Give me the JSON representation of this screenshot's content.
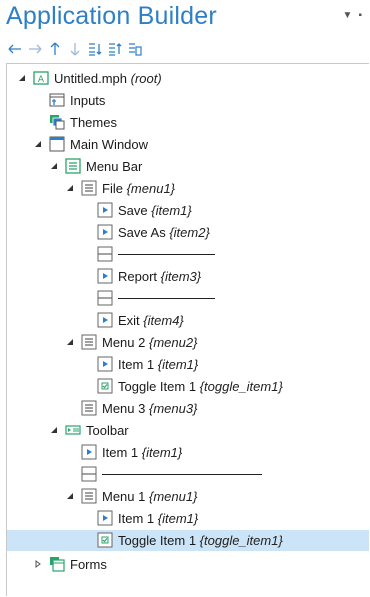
{
  "header": {
    "title": "Application Builder",
    "menu_icons": [
      "pin-icon",
      "close-icon"
    ],
    "toolbar_icons": [
      "back-arrow-icon",
      "forward-arrow-icon",
      "move-up-icon",
      "move-down-icon",
      "tree-expand-icon",
      "tree-collapse-icon",
      "tree-settings-icon"
    ]
  },
  "tree": {
    "root": {
      "label": "Untitled.mph",
      "tag": "(root)"
    },
    "inputs": "Inputs",
    "themes": "Themes",
    "main_window": "Main Window",
    "menu_bar": "Menu Bar",
    "file": {
      "label": "File",
      "tag": "{menu1}"
    },
    "save": {
      "label": "Save",
      "tag": "{item1}"
    },
    "save_as": {
      "label": "Save As",
      "tag": "{item2}"
    },
    "report": {
      "label": "Report",
      "tag": "{item3}"
    },
    "exit": {
      "label": "Exit",
      "tag": "{item4}"
    },
    "menu2": {
      "label": "Menu 2",
      "tag": "{menu2}"
    },
    "menu2_item1": {
      "label": "Item 1",
      "tag": "{item1}"
    },
    "menu2_toggle": {
      "label": "Toggle Item 1",
      "tag": "{toggle_item1}"
    },
    "menu3": {
      "label": "Menu 3",
      "tag": "{menu3}"
    },
    "toolbar": "Toolbar",
    "tb_item1": {
      "label": "Item 1",
      "tag": "{item1}"
    },
    "tb_menu1": {
      "label": "Menu 1",
      "tag": "{menu1}"
    },
    "tb_menu1_item1": {
      "label": "Item 1",
      "tag": "{item1}"
    },
    "tb_menu1_toggle": {
      "label": "Toggle Item 1",
      "tag": "{toggle_item1}"
    },
    "forms": "Forms"
  },
  "colors": {
    "title": "#2f7fc6",
    "selected_row": "#cce4f7",
    "icon_blue": "#2a7fd0",
    "icon_green": "#2aa36b"
  }
}
